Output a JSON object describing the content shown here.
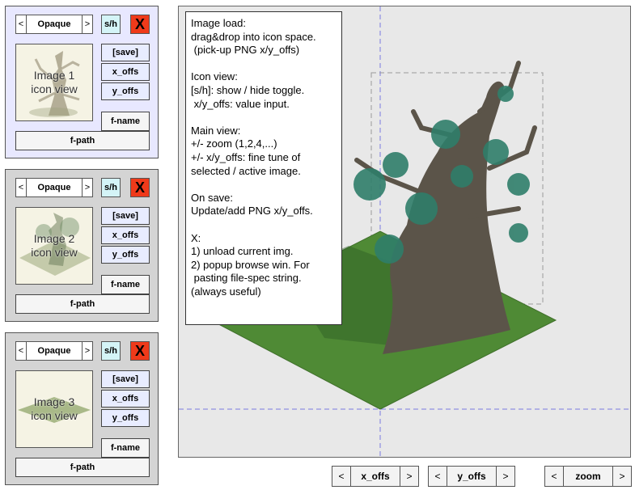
{
  "panels": [
    {
      "opacity_select": {
        "prev": "<",
        "value": "Opaque",
        "next": ">"
      },
      "sh_label": "s/h",
      "x_label": "X",
      "icon_label": "Image 1\nicon view",
      "save_label": "[save]",
      "x_offs_label": "x_offs",
      "y_offs_label": "y_offs",
      "fname_label": "f-name",
      "fpath_label": "f-path",
      "bg_color": "#e8e8ff"
    },
    {
      "opacity_select": {
        "prev": "<",
        "value": "Opaque",
        "next": ">"
      },
      "sh_label": "s/h",
      "x_label": "X",
      "icon_label": "Image 2\nicon view",
      "save_label": "[save]",
      "x_offs_label": "x_offs",
      "y_offs_label": "y_offs",
      "fname_label": "f-name",
      "fpath_label": "f-path",
      "bg_color": "#d4d4d4"
    },
    {
      "opacity_select": {
        "prev": "<",
        "value": "Opaque",
        "next": ">"
      },
      "sh_label": "s/h",
      "x_label": "X",
      "icon_label": "Image 3\nicon view",
      "save_label": "[save]",
      "x_offs_label": "x_offs",
      "y_offs_label": "y_offs",
      "fname_label": "f-name",
      "fpath_label": "f-path",
      "bg_color": "#d4d4d4"
    }
  ],
  "help_text": "Image load:\ndrag&drop into icon space.\n (pick-up PNG x/y_offs)\n\nIcon view:\n[s/h]: show / hide toggle.\n x/y_offs: value input.\n\nMain view:\n+/- zoom (1,2,4,...)\n+/- x/y_offs: fine tune of\nselected / active image.\n\nOn save:\nUpdate/add PNG x/y_offs.\n\nX:\n1) unload current img.\n2) popup browse win. For\n pasting file-spec string.\n(always useful)",
  "bottom_controls": {
    "x_offs": {
      "prev": "<",
      "label": "x_offs",
      "next": ">"
    },
    "y_offs": {
      "prev": "<",
      "label": "y_offs",
      "next": ">"
    },
    "zoom": {
      "prev": "<",
      "label": "zoom",
      "next": ">"
    }
  },
  "colors": {
    "active_panel_bg": "#e8e8ff",
    "inactive_panel_bg": "#d4d4d4",
    "close_button": "#ef3a1a",
    "sh_button": "#d4f4f7",
    "main_bg": "#e8e8e8",
    "crosshair": "#7a7ae0",
    "grass": "#4f8a35"
  }
}
